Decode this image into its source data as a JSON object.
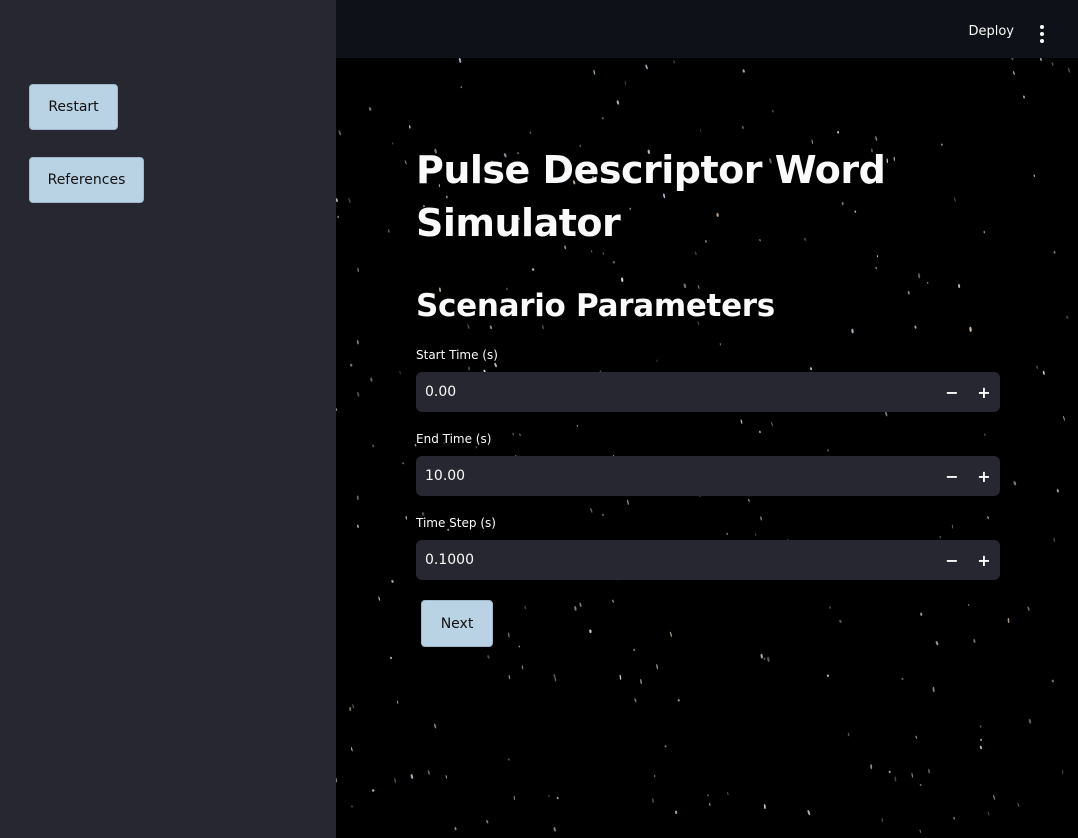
{
  "sidebar": {
    "buttons": [
      {
        "label": "Restart"
      },
      {
        "label": "References"
      }
    ]
  },
  "header": {
    "deploy_label": "Deploy",
    "menu_icon": "kebab-menu-icon"
  },
  "main": {
    "title": "Pulse Descriptor Word Simulator",
    "section_title": "Scenario Parameters",
    "fields": [
      {
        "label": "Start Time (s)",
        "value": "0.00",
        "minus": "−",
        "plus": "+"
      },
      {
        "label": "End Time (s)",
        "value": "10.00",
        "minus": "−",
        "plus": "+"
      },
      {
        "label": "Time Step (s)",
        "value": "0.1000",
        "minus": "−",
        "plus": "+"
      }
    ],
    "next_label": "Next"
  },
  "colors": {
    "sidebar_bg": "#262730",
    "header_bg": "#0e1117",
    "main_bg": "#000000",
    "button_bg": "#b9d2e4",
    "input_bg": "#262730",
    "text": "#fafafa"
  }
}
